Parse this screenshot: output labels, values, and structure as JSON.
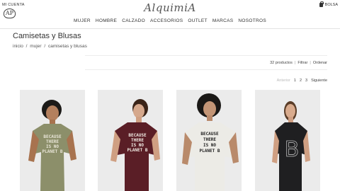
{
  "header": {
    "account_label": "MI CUENTA",
    "mini_logo_text": "AP",
    "logo_text": "AlquimiA",
    "bag_label": "BOLSA"
  },
  "nav": {
    "items": [
      "MUJER",
      "HOMBRE",
      "CALZADO",
      "ACCESORIOS",
      "OUTLET",
      "MARCAS",
      "NOSOTROS"
    ]
  },
  "page": {
    "title": "Camisetas y Blusas",
    "breadcrumb": [
      "inicio",
      "/",
      "mujer",
      "/",
      "camisetas y blusas"
    ]
  },
  "toolbar": {
    "count": "32 productos",
    "sep1": "|",
    "filter": "Filtrar",
    "sep2": "|",
    "sort": "Ordenar"
  },
  "pager": {
    "prev": "Anterior",
    "sep": "1",
    "page2": "2",
    "page3": "3",
    "next": "Siguiente"
  },
  "products": [
    {
      "shirt_color": "#8c8f6a",
      "print": [
        "BECAUSE",
        "THERE",
        "IS NO",
        "PLANET B"
      ],
      "print_color": "#e8e4d6"
    },
    {
      "shirt_color": "#5a1e26",
      "print": [
        "BECAUSE",
        "THERE",
        "IS NO",
        "PLANET B"
      ],
      "print_color": "#f1ece4"
    },
    {
      "shirt_color": "#ecebe6",
      "print": [
        "BECAUSE",
        "THERE",
        "IS NO",
        "PLANET B"
      ],
      "print_color": "#222222"
    },
    {
      "shirt_color": "#1f1f21",
      "print": [
        "B"
      ],
      "print_color": "#bdbdbd"
    }
  ]
}
